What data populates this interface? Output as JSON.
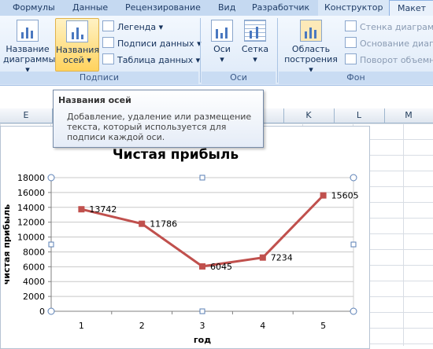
{
  "tabs": [
    {
      "label": "Формулы"
    },
    {
      "label": "Данные"
    },
    {
      "label": "Рецензирование"
    },
    {
      "label": "Вид"
    },
    {
      "label": "Разработчик"
    },
    {
      "label": "Конструктор"
    },
    {
      "label": "Макет"
    }
  ],
  "ribbon": {
    "chart_title_btn": {
      "line1": "Название",
      "line2": "диаграммы ▾"
    },
    "axis_titles_btn": {
      "line1": "Названия",
      "line2": "осей ▾"
    },
    "legend_btn": "Легенда ▾",
    "data_labels_btn": "Подписи данных ▾",
    "data_table_btn": "Таблица данных ▾",
    "labels_group": "Подписи",
    "axes_btn": {
      "line1": "Оси",
      "line2": "▾"
    },
    "gridlines_btn": {
      "line1": "Сетка",
      "line2": "▾"
    },
    "axes_group": "Оси",
    "plot_area_btn": {
      "line1": "Область",
      "line2": "построения ▾"
    },
    "chart_wall_btn": "Стенка диаграмм",
    "chart_floor_btn": "Основание диагр",
    "rotation_btn": "Поворот объемно",
    "background_group": "Фон"
  },
  "tooltip": {
    "title": "Названия осей",
    "body": "Добавление, удаление или размещение текста, который используется для подписи каждой оси."
  },
  "columns": [
    "E",
    "K",
    "L",
    "M"
  ],
  "chart_data": {
    "type": "line",
    "title": "Чистая прибыль",
    "xlabel": "год",
    "ylabel": "чистая прибыль",
    "categories": [
      "1",
      "2",
      "3",
      "4",
      "5"
    ],
    "series": [
      {
        "values": [
          13742,
          11786,
          6045,
          7234,
          15605
        ]
      }
    ],
    "ylim": [
      0,
      18000
    ],
    "yticks": [
      0,
      2000,
      4000,
      6000,
      8000,
      10000,
      12000,
      14000,
      16000,
      18000
    ],
    "grid": true,
    "line_color": "#c0504d"
  }
}
